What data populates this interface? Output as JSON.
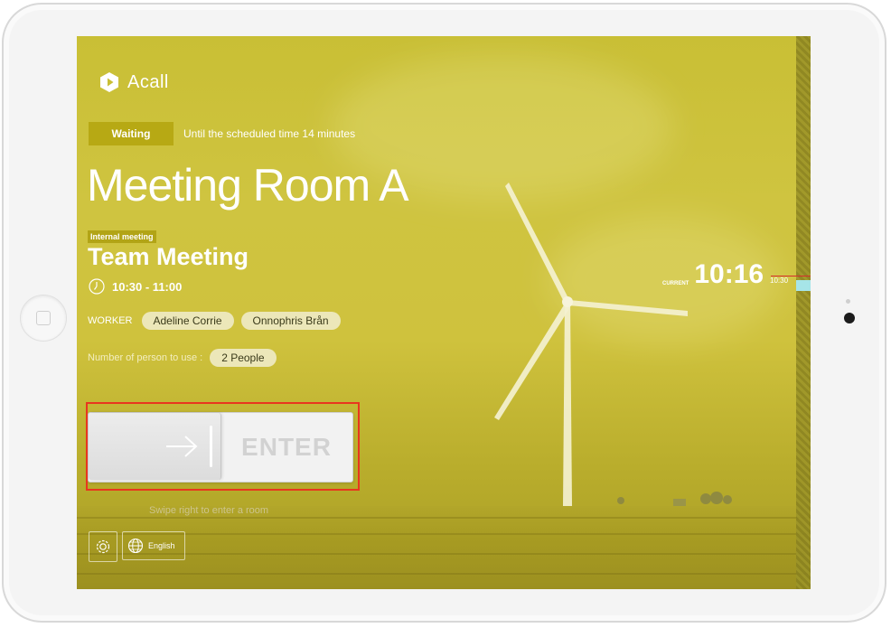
{
  "app": {
    "logo_text": "Acall"
  },
  "status": {
    "badge": "Waiting",
    "message": "Until the scheduled time 14 minutes"
  },
  "room": {
    "name": "Meeting Room A"
  },
  "meeting": {
    "type_badge": "Internal meeting",
    "title": "Team Meeting",
    "time_range": "10:30 - 11:00",
    "worker_label": "WORKER",
    "workers": [
      "Adeline Corrie",
      "Onnophris Brån"
    ],
    "people_label": "Number of person to use :",
    "people_count": "2 People"
  },
  "clock": {
    "label": "CURRENT",
    "time": "10:16",
    "timeline_time": "10:30"
  },
  "enter": {
    "label": "ENTER",
    "hint": "Swipe right to enter a room"
  },
  "footer": {
    "language": "English"
  },
  "icons": {
    "logo": "acall-logo-icon",
    "time": "clock-icon",
    "enter": "arrow-right-icon",
    "settings": "gear-icon",
    "language": "globe-icon"
  },
  "colors": {
    "screen_tint": "#cfc440",
    "status_badge": "#b7a914",
    "chip_bg": "#ece7b9",
    "highlight": "#e8361f"
  }
}
